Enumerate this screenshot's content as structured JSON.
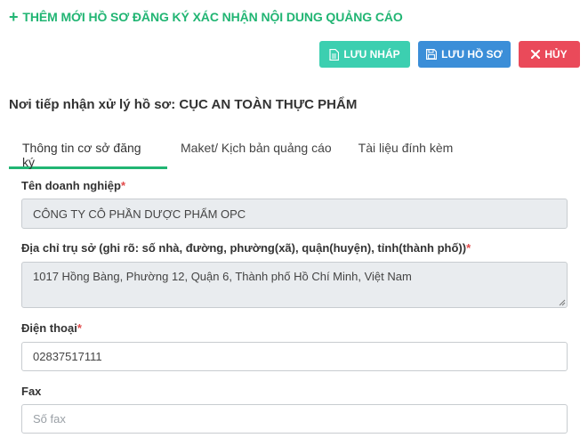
{
  "header": {
    "title": "THÊM MỚI HỒ SƠ ĐĂNG KÝ XÁC NHẬN NỘI DUNG QUẢNG CÁO",
    "plus_icon": "plus-icon"
  },
  "toolbar": {
    "draft_label": "LƯU NHÁP",
    "save_label": "LƯU HỒ SƠ",
    "cancel_label": "HỦY",
    "draft_color": "#3ccfb0",
    "save_color": "#3b8ed8",
    "cancel_color": "#ea4a5a"
  },
  "receiver": {
    "text": "Nơi tiếp nhận xử lý hồ sơ: CỤC AN TOÀN THỰC PHẨM"
  },
  "tabs": [
    {
      "label": "Thông tin cơ sở đăng ký",
      "active": true
    },
    {
      "label": "Maket/ Kịch bản quảng cáo",
      "active": false
    },
    {
      "label": "Tài liệu đính kèm",
      "active": false
    }
  ],
  "form": {
    "company": {
      "label": "Tên doanh nghiệp",
      "required": "*",
      "value": "CÔNG TY CÔ PHẦN DƯỢC PHẨM OPC"
    },
    "address": {
      "label": "Địa chỉ trụ sở (ghi rõ: số nhà, đường, phường(xã), quận(huyện), tỉnh(thành phố))",
      "required": "*",
      "value": "1017 Hồng Bàng, Phường 12, Quận 6, Thành phố Hồ Chí Minh, Việt Nam"
    },
    "phone": {
      "label": "Điện thoại",
      "required": "*",
      "value": "02837517111"
    },
    "fax": {
      "label": "Fax",
      "placeholder": "Số fax",
      "value": ""
    }
  },
  "colors": {
    "accent": "#21b573",
    "required": "#e14a4a"
  }
}
